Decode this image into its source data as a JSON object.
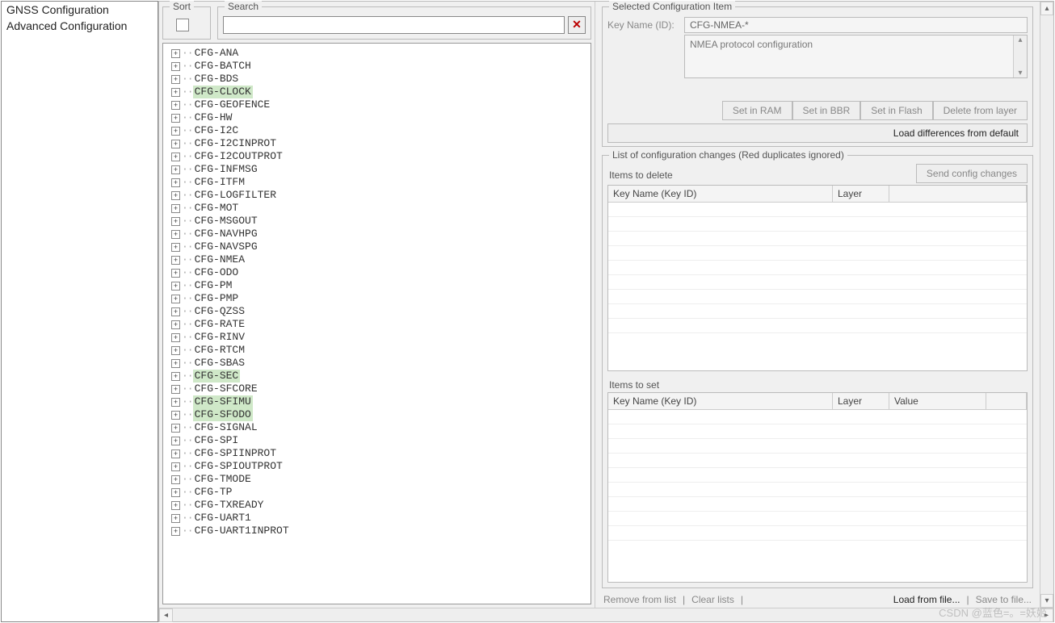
{
  "sidebar": {
    "items": [
      {
        "label": "GNSS Configuration"
      },
      {
        "label": "Advanced Configuration"
      }
    ]
  },
  "sort": {
    "legend": "Sort"
  },
  "search": {
    "legend": "Search",
    "value": "",
    "clear_icon": "✕"
  },
  "tree": {
    "items": [
      {
        "label": "CFG-ANA",
        "hl": false
      },
      {
        "label": "CFG-BATCH",
        "hl": false
      },
      {
        "label": "CFG-BDS",
        "hl": false
      },
      {
        "label": "CFG-CLOCK",
        "hl": true
      },
      {
        "label": "CFG-GEOFENCE",
        "hl": false
      },
      {
        "label": "CFG-HW",
        "hl": false
      },
      {
        "label": "CFG-I2C",
        "hl": false
      },
      {
        "label": "CFG-I2CINPROT",
        "hl": false
      },
      {
        "label": "CFG-I2COUTPROT",
        "hl": false
      },
      {
        "label": "CFG-INFMSG",
        "hl": false
      },
      {
        "label": "CFG-ITFM",
        "hl": false
      },
      {
        "label": "CFG-LOGFILTER",
        "hl": false
      },
      {
        "label": "CFG-MOT",
        "hl": false
      },
      {
        "label": "CFG-MSGOUT",
        "hl": false
      },
      {
        "label": "CFG-NAVHPG",
        "hl": false
      },
      {
        "label": "CFG-NAVSPG",
        "hl": false
      },
      {
        "label": "CFG-NMEA",
        "hl": false
      },
      {
        "label": "CFG-ODO",
        "hl": false
      },
      {
        "label": "CFG-PM",
        "hl": false
      },
      {
        "label": "CFG-PMP",
        "hl": false
      },
      {
        "label": "CFG-QZSS",
        "hl": false
      },
      {
        "label": "CFG-RATE",
        "hl": false
      },
      {
        "label": "CFG-RINV",
        "hl": false
      },
      {
        "label": "CFG-RTCM",
        "hl": false
      },
      {
        "label": "CFG-SBAS",
        "hl": false
      },
      {
        "label": "CFG-SEC",
        "hl": true
      },
      {
        "label": "CFG-SFCORE",
        "hl": false
      },
      {
        "label": "CFG-SFIMU",
        "hl": true
      },
      {
        "label": "CFG-SFODO",
        "hl": true
      },
      {
        "label": "CFG-SIGNAL",
        "hl": false
      },
      {
        "label": "CFG-SPI",
        "hl": false
      },
      {
        "label": "CFG-SPIINPROT",
        "hl": false
      },
      {
        "label": "CFG-SPIOUTPROT",
        "hl": false
      },
      {
        "label": "CFG-TMODE",
        "hl": false
      },
      {
        "label": "CFG-TP",
        "hl": false
      },
      {
        "label": "CFG-TXREADY",
        "hl": false
      },
      {
        "label": "CFG-UART1",
        "hl": false
      },
      {
        "label": "CFG-UART1INPROT",
        "hl": false
      }
    ]
  },
  "selected": {
    "legend": "Selected Configuration Item",
    "key_label": "Key Name (ID):",
    "key_value": "CFG-NMEA-*",
    "desc": "NMEA protocol configuration",
    "buttons": {
      "ram": "Set in RAM",
      "bbr": "Set in BBR",
      "flash": "Set in Flash",
      "del_layer": "Delete from layer"
    },
    "load_diff": "Load differences from default"
  },
  "changes": {
    "legend": "List of configuration changes (Red duplicates ignored)",
    "send": "Send config changes",
    "delete": {
      "title": "Items to delete",
      "cols": {
        "key": "Key Name (Key ID)",
        "layer": "Layer"
      }
    },
    "set": {
      "title": "Items to set",
      "cols": {
        "key": "Key Name (Key ID)",
        "layer": "Layer",
        "value": "Value"
      }
    }
  },
  "footer": {
    "remove": "Remove from list",
    "clear": "Clear lists",
    "load": "Load from file...",
    "save": "Save to file..."
  },
  "watermark": "CSDN @蓝色=。=妖姬"
}
